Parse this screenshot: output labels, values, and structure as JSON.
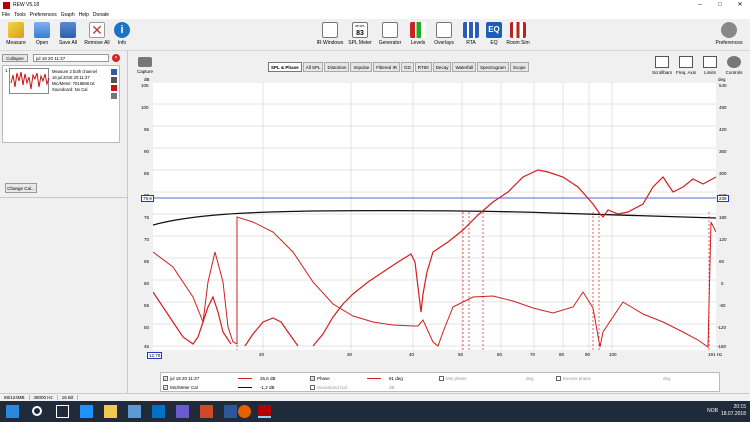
{
  "window": {
    "title": "REW V5.18",
    "buttons": [
      "–",
      "□",
      "✕"
    ]
  },
  "menu": [
    "File",
    "Tools",
    "Preferences",
    "Graph",
    "Help",
    "Donate"
  ],
  "toolbar": {
    "left": [
      {
        "label": "Measure",
        "icon": "measure-icon",
        "color": "#d4a017"
      },
      {
        "label": "Open",
        "icon": "open-folder-icon",
        "color": "#3a7bd5"
      },
      {
        "label": "Save All",
        "icon": "save-all-icon",
        "color": "#2d5fa8"
      },
      {
        "label": "Remove All",
        "icon": "remove-all-icon",
        "color": "#c0392b"
      },
      {
        "label": "Info",
        "icon": "info-icon",
        "color": "#1a73c9"
      }
    ],
    "center": [
      {
        "label": "IR Windows",
        "icon": "ir-windows-icon"
      },
      {
        "label": "SPL Meter",
        "icon": "spl-meter-icon",
        "badge": "83",
        "badge_top": "dB SPL"
      },
      {
        "label": "Generator",
        "icon": "generator-icon"
      },
      {
        "label": "Levels",
        "icon": "levels-icon"
      },
      {
        "label": "Overlays",
        "icon": "overlays-icon"
      },
      {
        "label": "RTA",
        "icon": "rta-icon"
      },
      {
        "label": "EQ",
        "icon": "eq-icon"
      },
      {
        "label": "Room Sim",
        "icon": "room-sim-icon"
      }
    ],
    "right": {
      "label": "Preferences",
      "icon": "preferences-icon"
    }
  },
  "left_panel": {
    "collapse_label": "Collapse",
    "measurement_name": "jul 18 20 11:37",
    "measurement_index": "1",
    "measurement_lines": [
      "Measure 2 both channel",
      "18.jul.2018 20:11:37",
      "Mic/Meter: 7018568.txt",
      "Soundcard: No Cal"
    ],
    "change_cal_label": "Change Cal..."
  },
  "capture": {
    "label": "Capture"
  },
  "tabs": [
    "SPL & Phase",
    "All SPL",
    "Distortion",
    "Impulse",
    "Filtered IR",
    "GD",
    "RT60",
    "Decay",
    "Waterfall",
    "Spectrogram",
    "Scope"
  ],
  "active_tab": "SPL & Phase",
  "right_tools": [
    {
      "label": "Scrollbars",
      "icon": "scrollbars-icon"
    },
    {
      "label": "Freq. Axis",
      "icon": "freq-axis-icon"
    },
    {
      "label": "Limits",
      "icon": "limits-icon"
    },
    {
      "label": "Controls",
      "icon": "controls-icon"
    }
  ],
  "graph": {
    "y_left_unit": "dB",
    "y_right_unit": "deg",
    "y_left_ticks": [
      "105",
      "100",
      "95",
      "90",
      "85",
      "80",
      "75",
      "70",
      "65",
      "60",
      "55",
      "50",
      "45"
    ],
    "y_right_ticks": [
      "540",
      "480",
      "420",
      "360",
      "300",
      "240",
      "180",
      "120",
      "60",
      "0",
      "-60",
      "-120",
      "-180"
    ],
    "x_ticks": [
      "20",
      "30",
      "40",
      "50",
      "60",
      "70",
      "80",
      "90",
      "100"
    ],
    "x_left_cursor": "12,70",
    "x_right_label": "191 Hz",
    "left_cursor_value": "79,9",
    "right_cursor_value": "239",
    "colors": {
      "spl": "#d11f1f",
      "phase": "#d11f1f",
      "mic_cal": "#111111",
      "cursor": "#2233cc",
      "grid": "#c8c8c8"
    }
  },
  "legend": {
    "row1": {
      "name": "jul 18 20 11:37",
      "spl_value": "26,6 dB",
      "phase_label": "Phase",
      "phase_value": "81 deg",
      "min_phase_label": "Min phase",
      "min_phase_unit": "deg",
      "excess_phase_label": "Excess phase",
      "excess_phase_unit": "deg"
    },
    "row2": {
      "name": "Mic/Meter Cal",
      "value": "-1,2 dB",
      "soundcard_label": "Soundcard Cal",
      "soundcard_unit": "dB"
    }
  },
  "status": [
    "68/124MB",
    "48000 Hz",
    "16 Bit"
  ],
  "tray": {
    "time": "20:15",
    "date": "18.07.2018",
    "lang": "NOB"
  }
}
